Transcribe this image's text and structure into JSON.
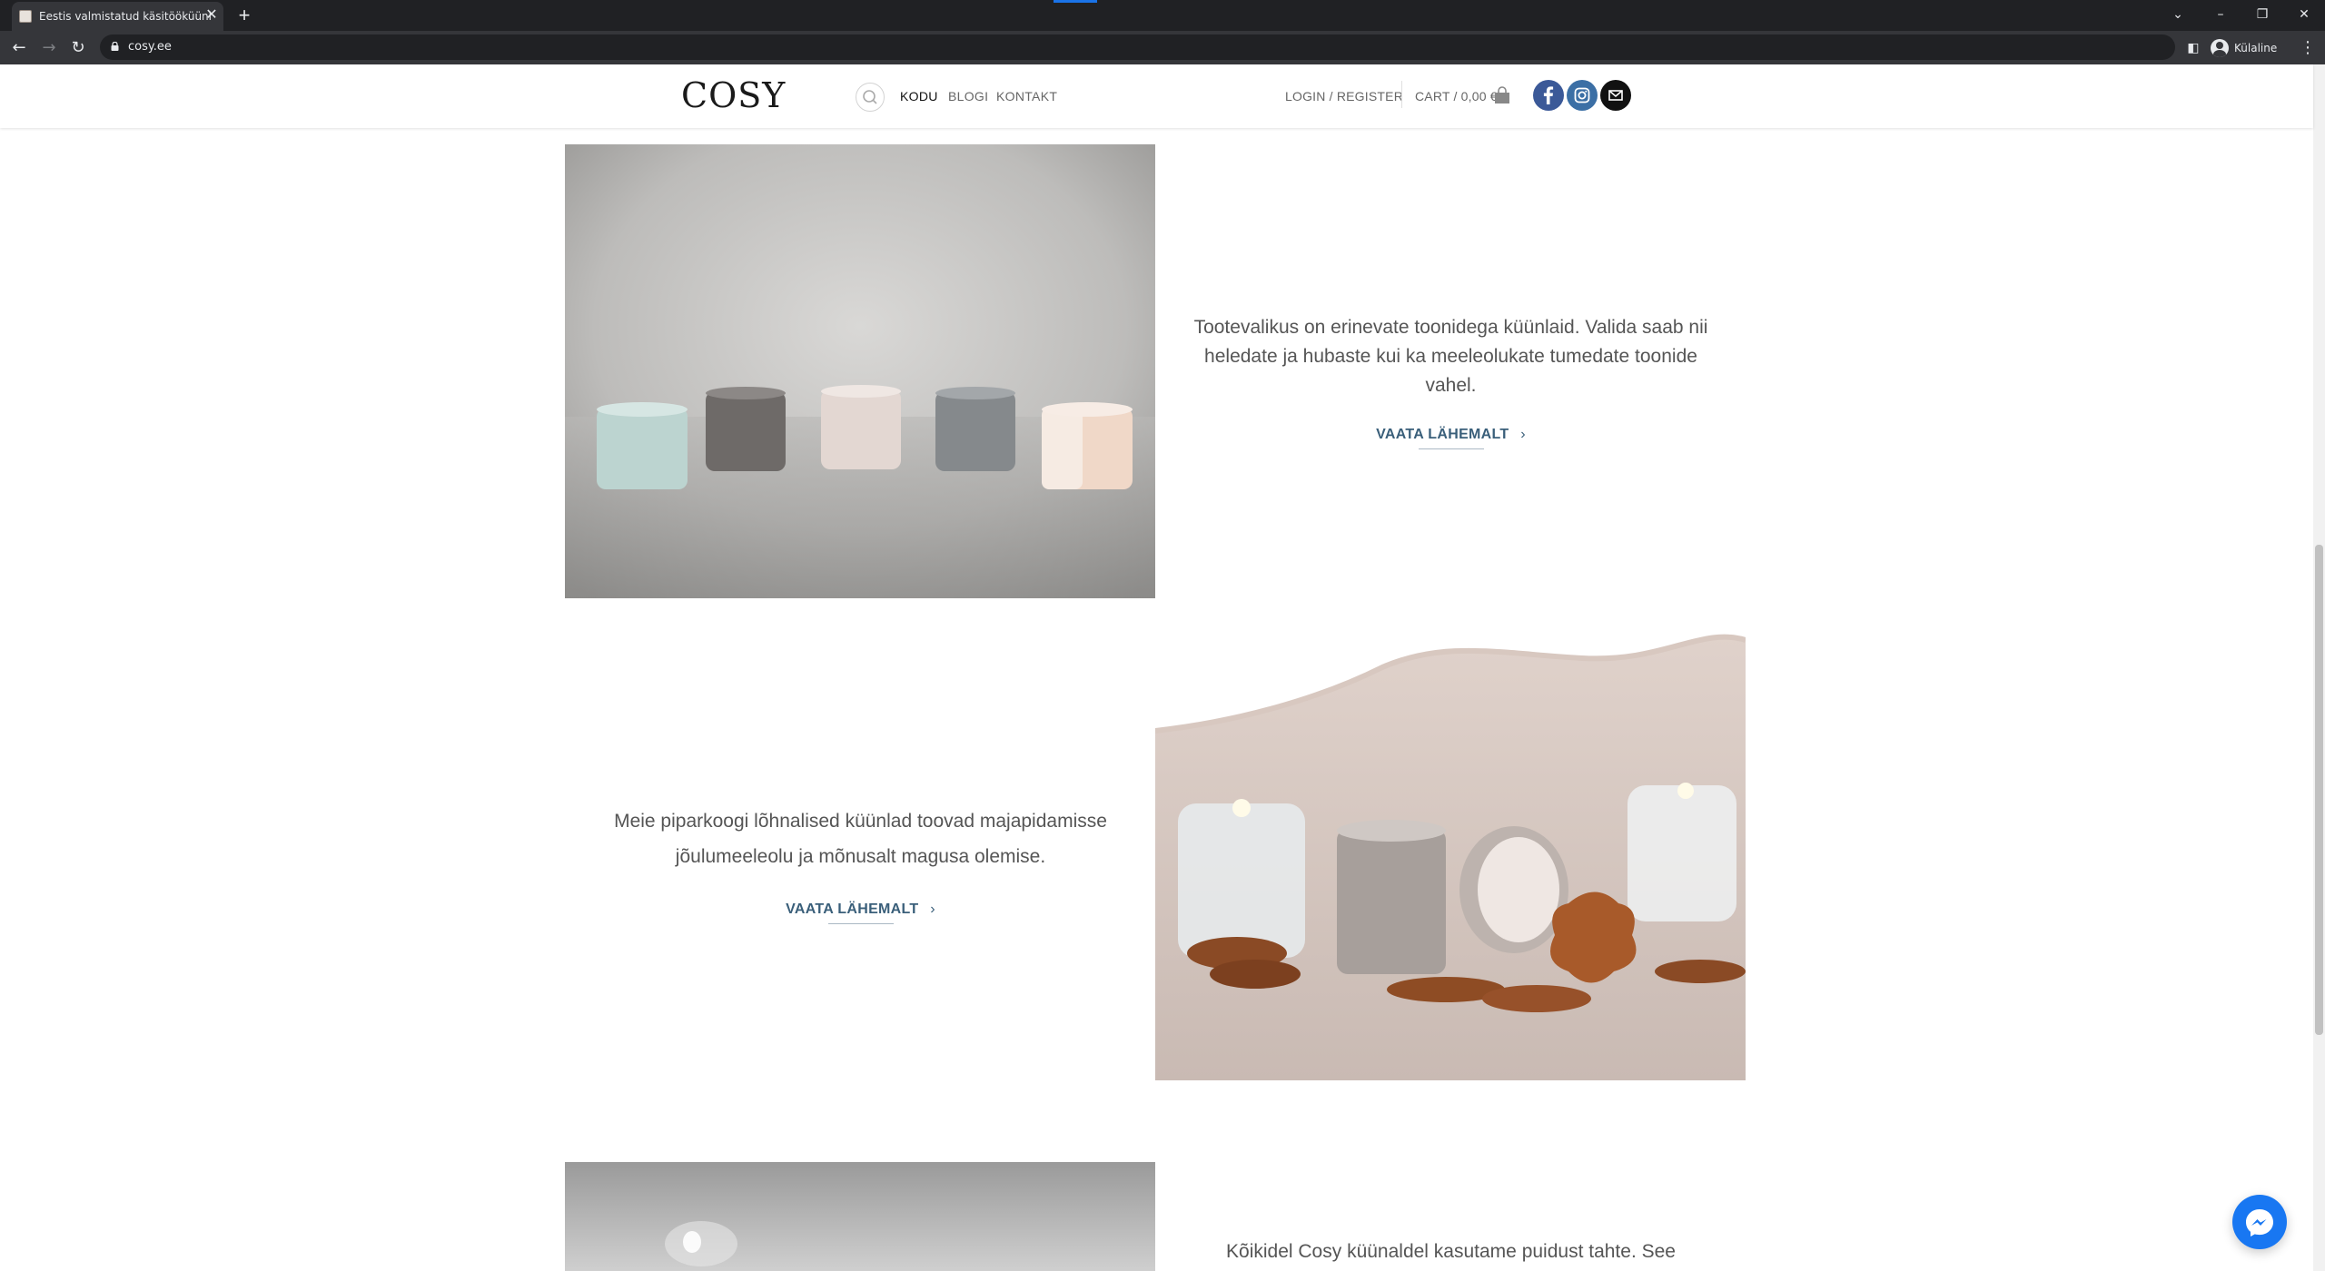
{
  "browser": {
    "tab_title": "Eestis valmistatud käsitööküünlad",
    "url": "cosy.ee",
    "profile_name": "Külaline"
  },
  "header": {
    "logo": "COSY",
    "menu": [
      "KODU",
      "BLOGI",
      "KONTAKT"
    ],
    "login": "LOGIN / REGISTER",
    "cart": "CART / 0,00 €"
  },
  "sections": [
    {
      "text": "Tootevalikus on erinevate toonidega küünlaid. Valida saab nii heledate ja hubaste kui ka meeleolukate tumedate toonide vahel.",
      "link": "VAATA LÄHEMALT"
    },
    {
      "text": "Meie piparkoogi lõhnalised küünlad toovad majapidamisse jõulumeeleolu ja mõnusalt magusa olemise.",
      "link": "VAATA LÄHEMALT"
    },
    {
      "text": "Kõikidel Cosy küünaldel kasutame puidust tahte. See",
      "link": ""
    }
  ],
  "colors": {
    "accent_link": "#3a5f7a",
    "facebook": "#3b5998",
    "instagram": "#3b6fa5",
    "email": "#111111",
    "messenger": "#1877f2"
  }
}
